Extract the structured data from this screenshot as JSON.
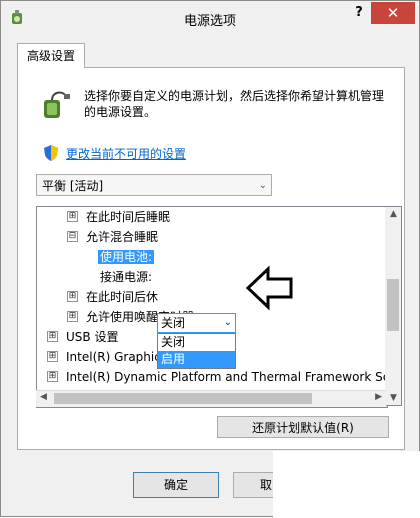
{
  "window": {
    "title": "电源选项",
    "help_label": "?",
    "close_label": "✕",
    "app_icon": "power-options-icon"
  },
  "tab": {
    "label": "高级设置"
  },
  "intro": {
    "text": "选择你要自定义的电源计划，然后选择你希望计算机管理的电源设置。",
    "icon": "power-plug-icon"
  },
  "link": {
    "text": "更改当前不可用的设置",
    "icon": "uac-shield-icon"
  },
  "plan_select": {
    "value": "平衡 [活动]"
  },
  "tree": {
    "items": [
      {
        "label": "在此时间后睡眠",
        "glyph": "⊞"
      },
      {
        "label": "允许混合睡眠",
        "glyph": "⊟"
      },
      {
        "label": "使用电池:",
        "glyph": ""
      },
      {
        "label": "接通电源:",
        "glyph": ""
      },
      {
        "label": "在此时间后休",
        "glyph": "⊞"
      },
      {
        "label": "允许使用唤醒定时器",
        "glyph": "⊞"
      },
      {
        "label": "USB 设置",
        "glyph": "⊞"
      },
      {
        "label": "Intel(R) Graphics Settings",
        "glyph": "⊞"
      },
      {
        "label": "Intel(R) Dynamic Platform and Thermal Framework Se",
        "glyph": "⊞"
      }
    ]
  },
  "inline_select": {
    "value": "关闭",
    "options": [
      "关闭",
      "启用"
    ],
    "highlighted": "启用"
  },
  "buttons": {
    "restore": "还原计划默认值(R)",
    "ok": "确定",
    "cancel": "取"
  },
  "colors": {
    "accent": "#3399ff",
    "link": "#0066cc",
    "close": "#c7453a"
  }
}
